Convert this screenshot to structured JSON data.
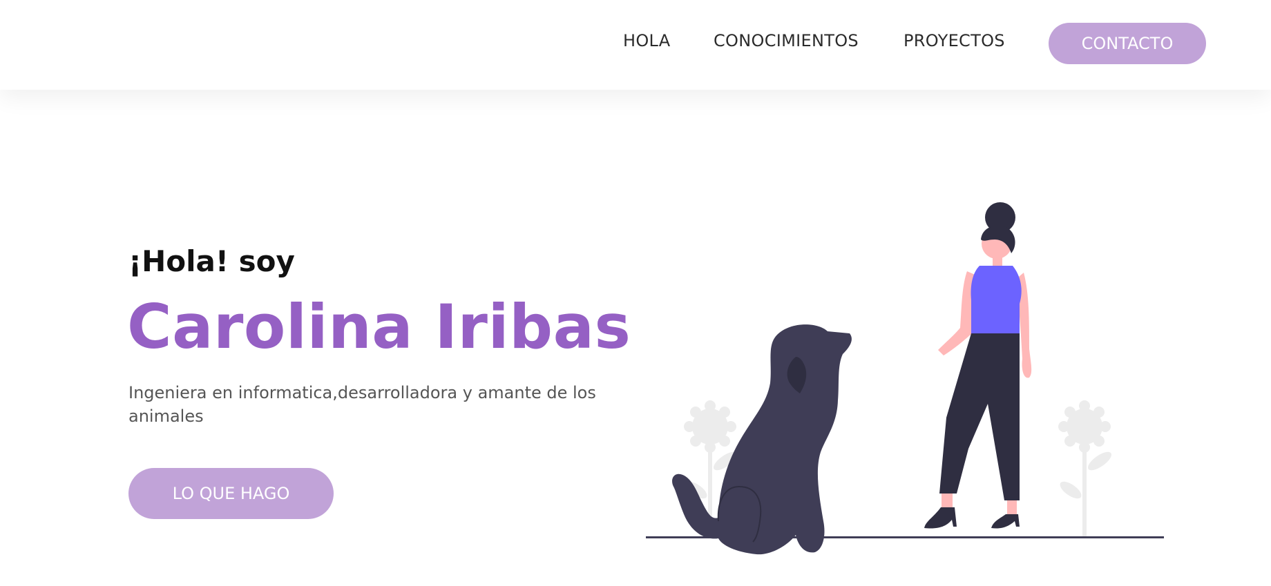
{
  "nav": {
    "items": [
      {
        "label": "HOLA"
      },
      {
        "label": "CONOCIMIENTOS"
      },
      {
        "label": "PROYECTOS"
      }
    ],
    "contact_label": "CONTACTO"
  },
  "hero": {
    "greeting": "¡Hola! soy",
    "name": "Carolina Iribas",
    "description": "Ingeniera en informatica,desarrolladora y amante de los animales",
    "cta_label": "LO QUE HAGO"
  },
  "colors": {
    "accent": "#9560c4",
    "button": "#c1a3d8",
    "illustration_top": "#6c63ff",
    "illustration_dark": "#3f3d56"
  },
  "icons": {
    "illustration": "woman-with-dog-illustration"
  }
}
